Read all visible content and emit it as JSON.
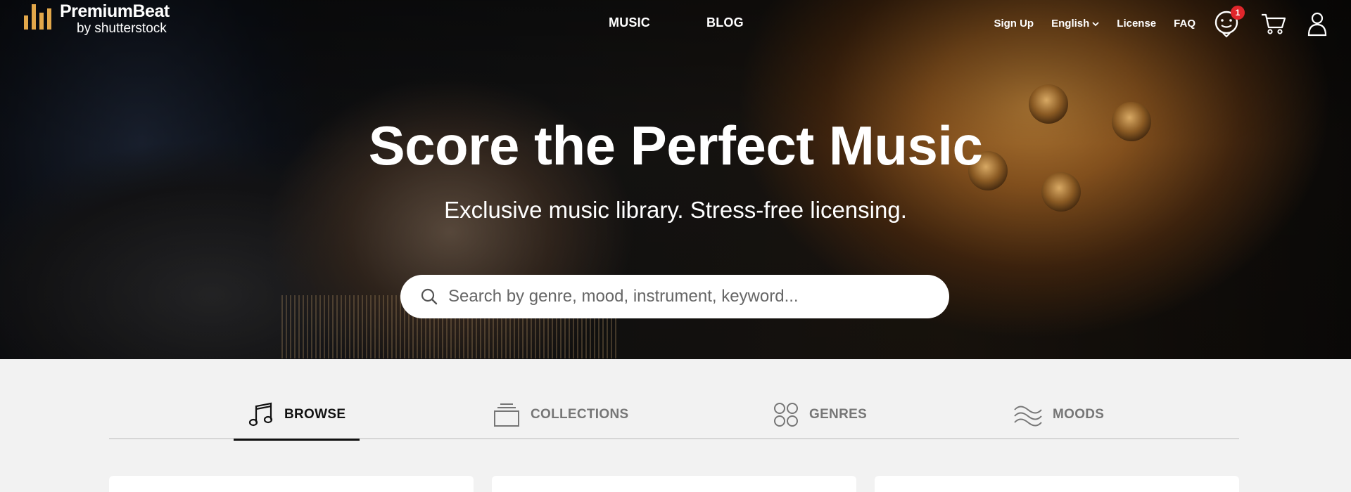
{
  "brand": {
    "name": "PremiumBeat",
    "sub": "by shutterstock",
    "accent_color": "#e2a74a"
  },
  "mainnav": {
    "items": [
      {
        "label": "MUSIC"
      },
      {
        "label": "BLOG"
      }
    ]
  },
  "utilnav": {
    "signup": "Sign Up",
    "language": "English",
    "license": "License",
    "faq": "FAQ"
  },
  "icons": {
    "assistant": "smiley-assistant-icon",
    "cart": "cart-icon",
    "account": "user-icon",
    "language_caret": "chevron-down-icon",
    "search": "search-icon"
  },
  "notifications": {
    "count": "1",
    "badge_color": "#e0262b"
  },
  "hero": {
    "title": "Score the Perfect Music",
    "subtitle": "Exclusive music library. Stress-free licensing."
  },
  "search": {
    "placeholder": "Search by genre, mood, instrument, keyword...",
    "value": ""
  },
  "tabs": [
    {
      "label": "BROWSE",
      "icon": "music-note-icon",
      "active": true
    },
    {
      "label": "COLLECTIONS",
      "icon": "collections-stack-icon",
      "active": false
    },
    {
      "label": "GENRES",
      "icon": "genres-circles-icon",
      "active": false
    },
    {
      "label": "MOODS",
      "icon": "moods-waves-icon",
      "active": false
    }
  ]
}
